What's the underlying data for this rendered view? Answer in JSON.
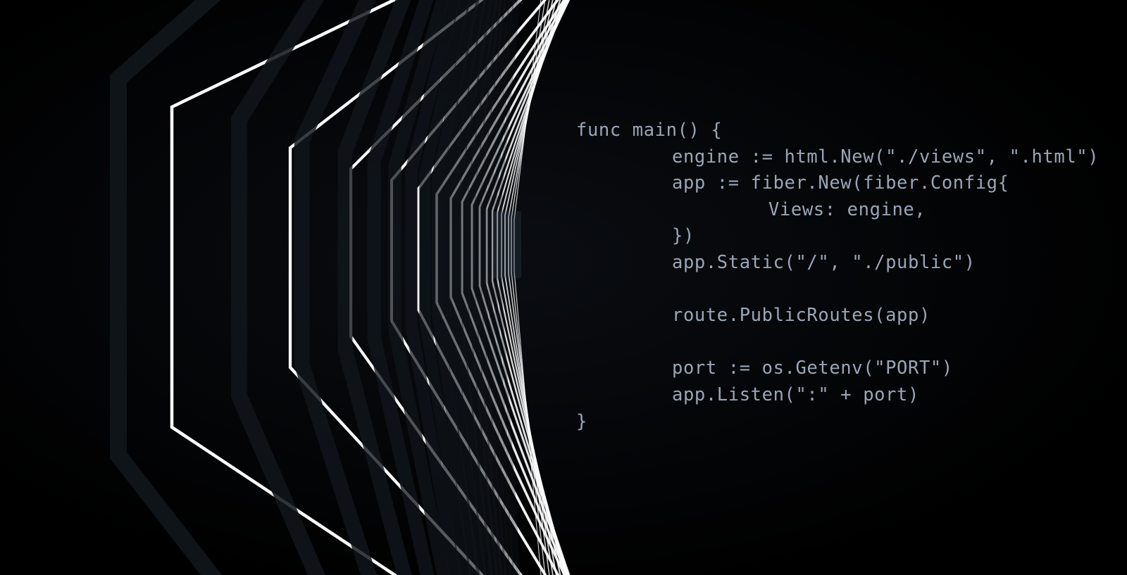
{
  "palette": {
    "background": "#000000",
    "neon_line": "#ffffff",
    "frame_shade": "#11161c",
    "code_text": "#9aa6b8"
  },
  "code": {
    "language": "go",
    "lines": [
      "func main() {",
      "engine := html.New(\"./views\", \".html\")",
      "app := fiber.New(fiber.Config{",
      "Views: engine,",
      "})",
      "app.Static(\"/\", \"./public\")",
      "",
      "route.PublicRoutes(app)",
      "",
      "port := os.Getenv(\"PORT\")",
      "app.Listen(\":\" + port)",
      "}"
    ]
  }
}
